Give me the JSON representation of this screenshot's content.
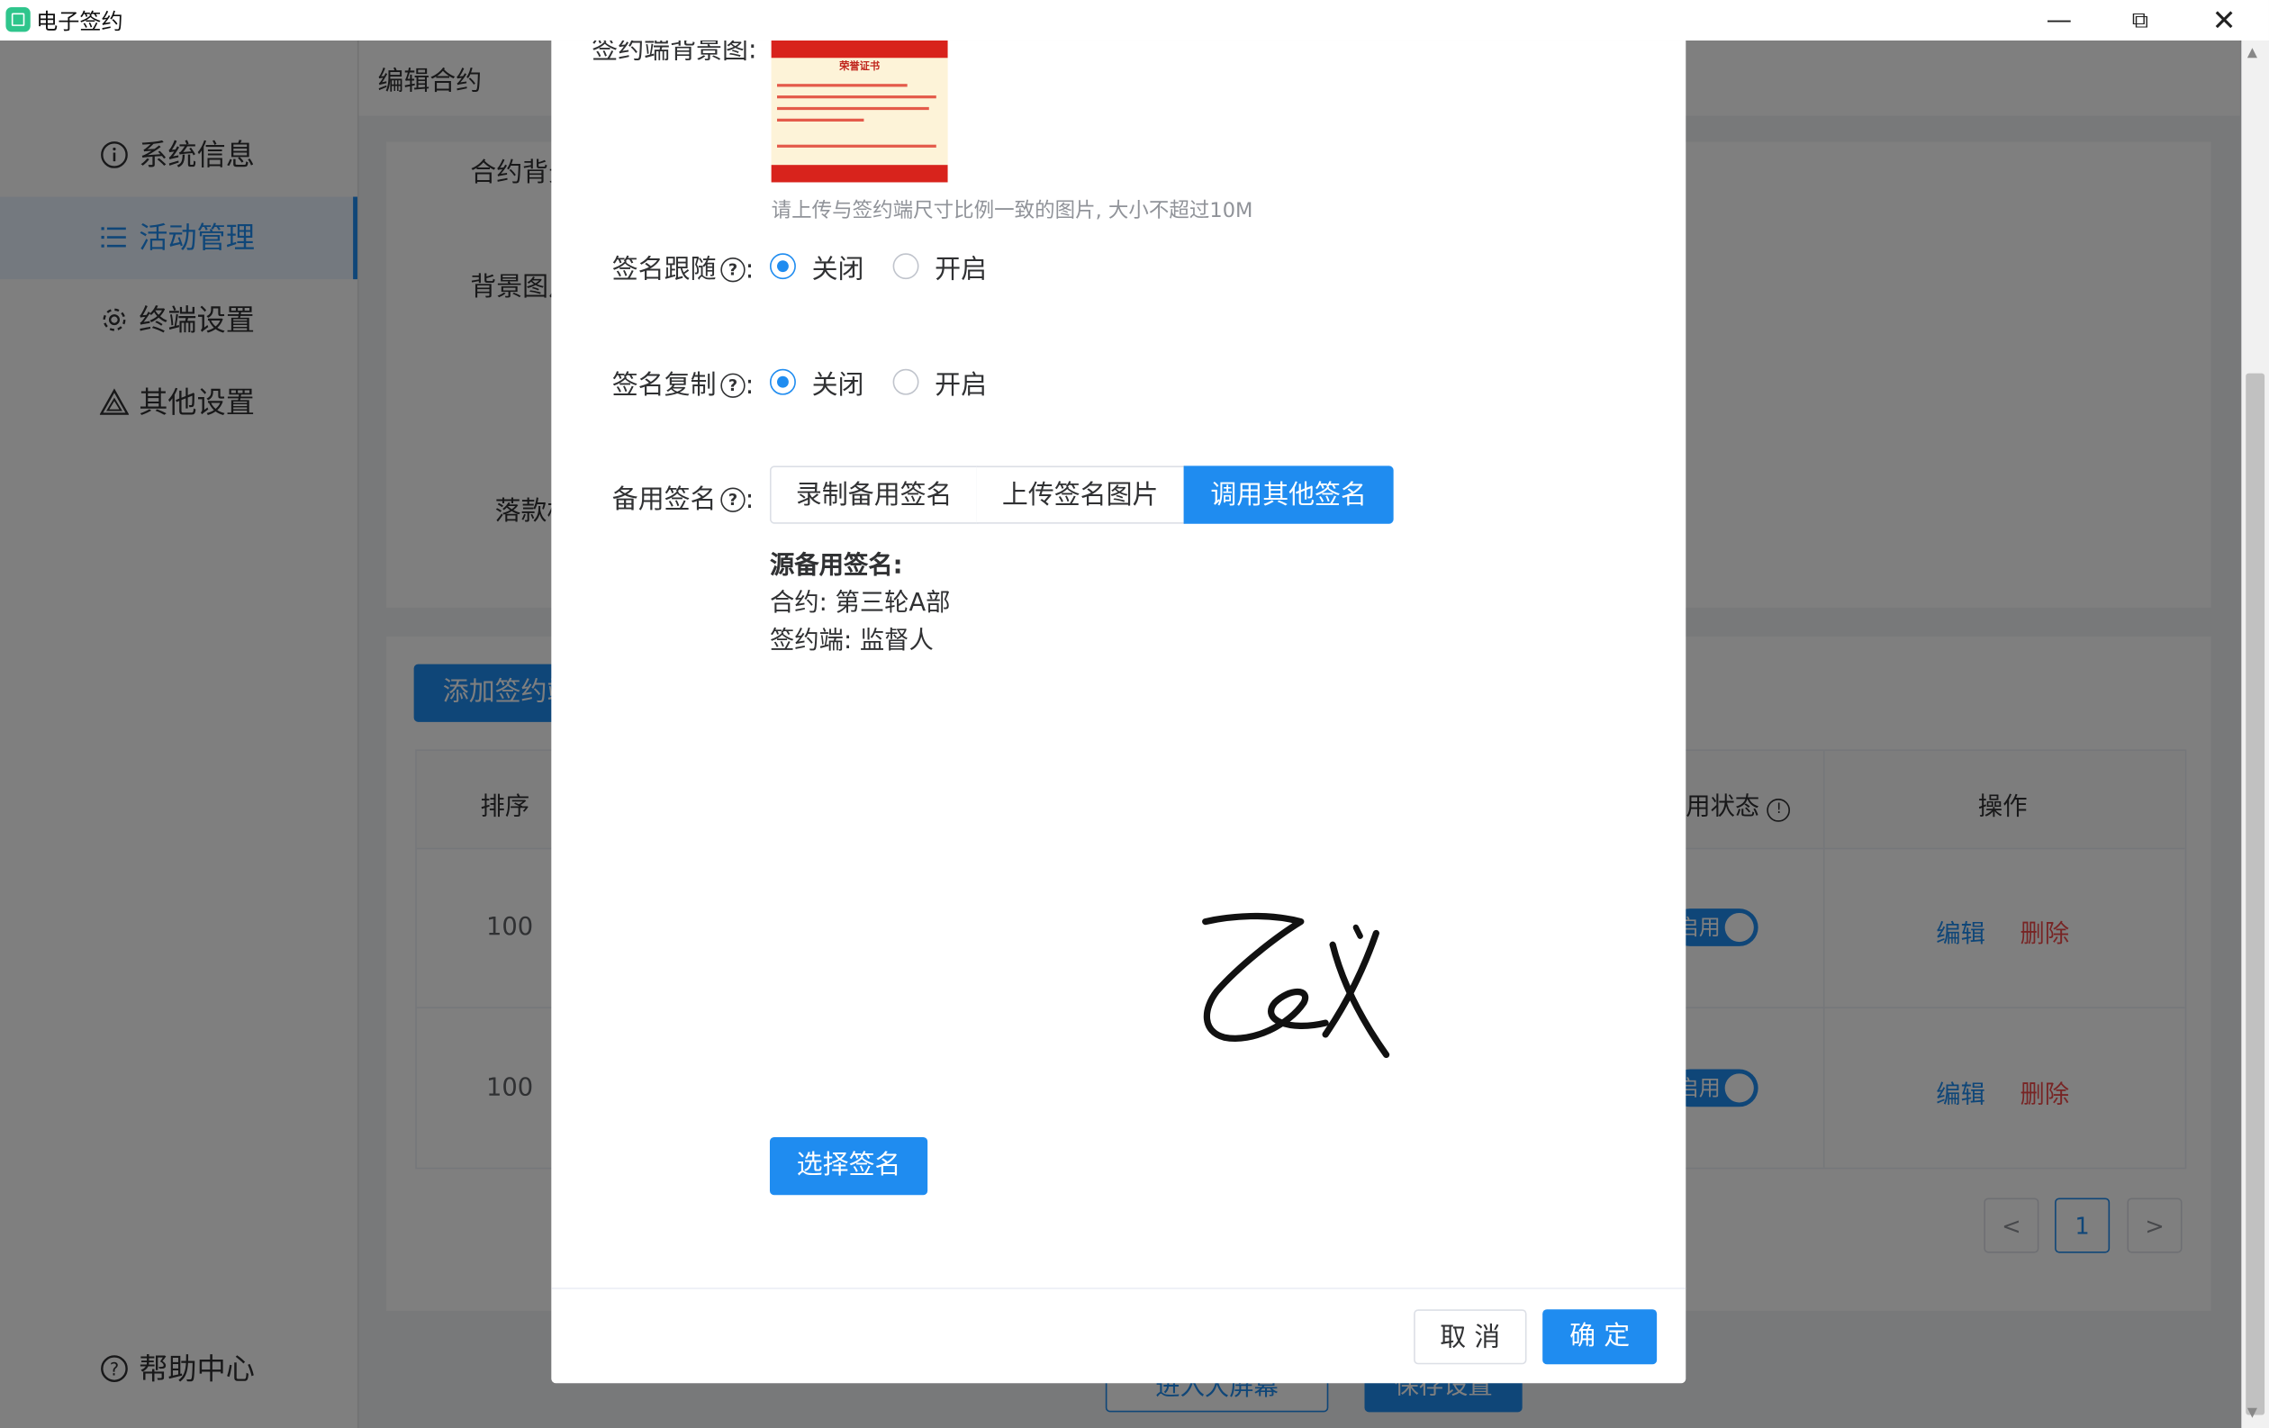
{
  "window": {
    "title": "电子签约",
    "controls": [
      "minimize-icon",
      "restore-icon",
      "close-icon"
    ]
  },
  "sidebar": {
    "items": [
      {
        "label": "系统信息",
        "icon": "info-icon"
      },
      {
        "label": "活动管理",
        "icon": "list-icon",
        "active": true
      },
      {
        "label": "终端设置",
        "icon": "gear-icon"
      },
      {
        "label": "其他设置",
        "icon": "warning-triangle-icon"
      }
    ],
    "help": {
      "label": "帮助中心",
      "icon": "help-circle-icon"
    }
  },
  "main": {
    "breadcrumb": "编辑合约",
    "form_labels": {
      "contract_bg": "合约背景",
      "bg_image": "背景图片",
      "inscription": "落款格式"
    },
    "add_button": "添加签约端",
    "table": {
      "headers": {
        "order": "排序",
        "status": "启用状态",
        "actions": "操作"
      },
      "rows": [
        {
          "order": "100",
          "status": "启用",
          "edit": "编辑",
          "delete": "删除"
        },
        {
          "order": "100",
          "status": "启用",
          "edit": "编辑",
          "delete": "删除"
        }
      ]
    },
    "pagination": {
      "prev": "<",
      "current": "1",
      "next": ">"
    },
    "bottom_buttons": {
      "big_screen": "进入大屏幕",
      "save": "保存设置"
    }
  },
  "modal": {
    "bg_label": "签约端背景图:",
    "thumb_caption": "荣誉证书",
    "hint": "请上传与签约端尺寸比例一致的图片, 大小不超过10M",
    "sign_follow": {
      "label": "签名跟随",
      "options": [
        "关闭",
        "开启"
      ],
      "selected": "关闭"
    },
    "sign_copy": {
      "label": "签名复制",
      "options": [
        "关闭",
        "开启"
      ],
      "selected": "关闭"
    },
    "backup_sign": {
      "label": "备用签名",
      "tabs": [
        "录制备用签名",
        "上传签名图片",
        "调用其他签名"
      ],
      "active_tab": "调用其他签名"
    },
    "source": {
      "title": "源备用签名:",
      "contract": "合约: 第三轮A部",
      "terminal": "签约端: 监督人"
    },
    "select_button": "选择签名",
    "cancel": "取 消",
    "confirm": "确 定"
  },
  "colors": {
    "accent": "#1f8cf0",
    "danger": "#f04b4b",
    "overlay": "rgba(0,0,0,0.5)"
  }
}
